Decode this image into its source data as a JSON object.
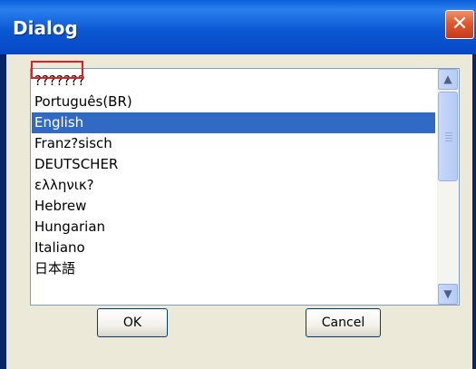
{
  "dialog": {
    "title": "Dialog",
    "close_label": "✕"
  },
  "language_list": {
    "items": [
      {
        "label": "???????",
        "selected": false
      },
      {
        "label": "Português(BR)",
        "selected": false
      },
      {
        "label": "English",
        "selected": true
      },
      {
        "label": "Franz?sisch",
        "selected": false
      },
      {
        "label": "DEUTSCHER",
        "selected": false
      },
      {
        "label": "ελληνικ?",
        "selected": false
      },
      {
        "label": "Hebrew",
        "selected": false
      },
      {
        "label": "Hungarian",
        "selected": false
      },
      {
        "label": "Italiano",
        "selected": false
      },
      {
        "label": "日本語",
        "selected": false
      }
    ],
    "scroll_up_icon": "▲",
    "scroll_down_icon": "▼"
  },
  "buttons": {
    "ok_label": "OK",
    "cancel_label": "Cancel"
  },
  "colors": {
    "selection": "#316ac5",
    "title_bar": "#0b58d4",
    "close_button": "#e2582e",
    "highlight": "#e02020"
  }
}
